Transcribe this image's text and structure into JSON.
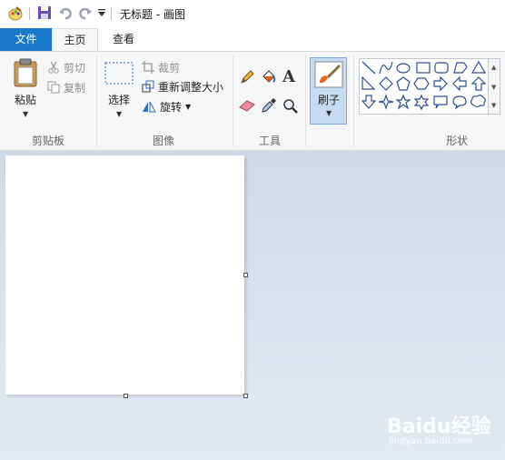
{
  "window": {
    "title": "无标题 - 画图"
  },
  "tabs": {
    "file": "文件",
    "home": "主页",
    "view": "查看"
  },
  "clipboard": {
    "paste": "粘贴",
    "cut": "剪切",
    "copy": "复制",
    "group_label": "剪贴板"
  },
  "image": {
    "select": "选择",
    "crop": "裁剪",
    "resize": "重新调整大小",
    "rotate": "旋转",
    "group_label": "图像"
  },
  "tools": {
    "group_label": "工具"
  },
  "brushes": {
    "label": "刷子"
  },
  "shapes": {
    "group_label": "形状"
  },
  "watermark": {
    "brand": "Baidu经验",
    "url": "jingyan.baidu.com"
  },
  "colors": {
    "accent": "#1979ca",
    "ribbon_bg": "#f5f6f7",
    "canvas_bg": "#cfd9e7",
    "selected_tool": "#c5dcf3"
  }
}
